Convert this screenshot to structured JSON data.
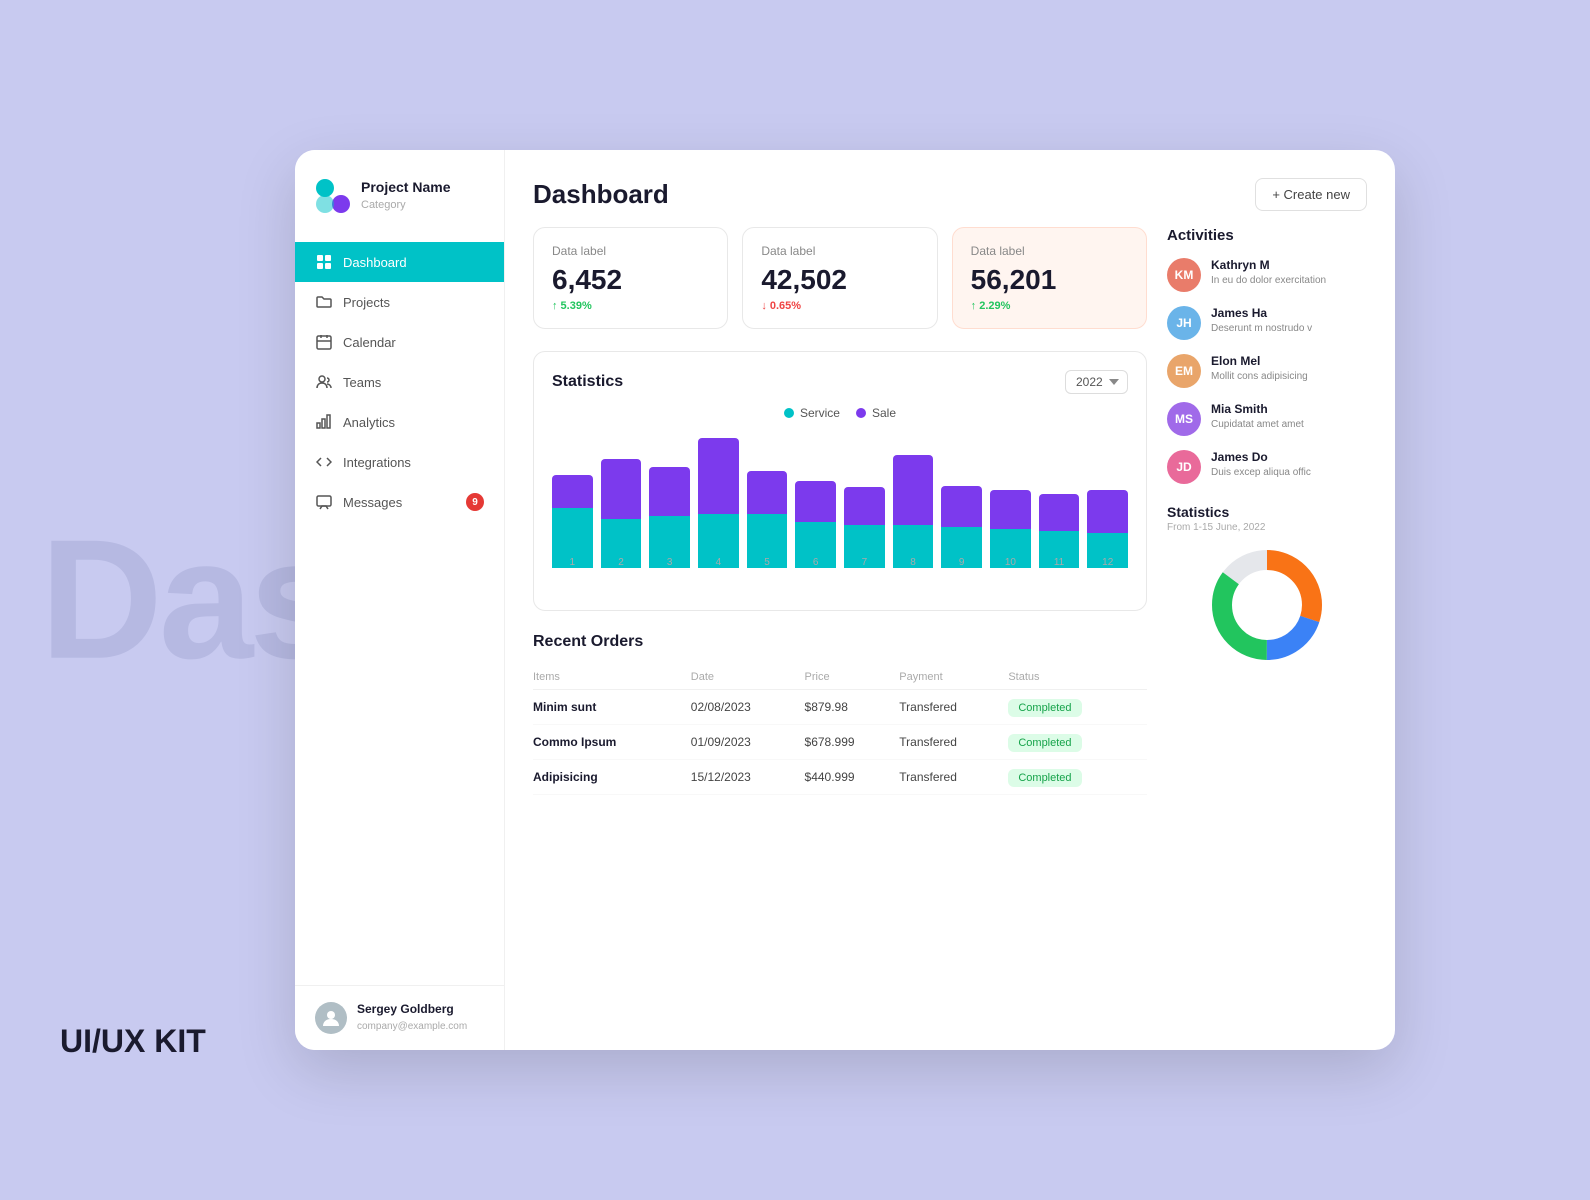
{
  "background_text": "Dashboard",
  "ui_kit_label": "UI/UX KIT",
  "logo": {
    "name": "Project Name",
    "category": "Category"
  },
  "nav": {
    "items": [
      {
        "id": "dashboard",
        "label": "Dashboard",
        "icon": "grid",
        "active": true
      },
      {
        "id": "projects",
        "label": "Projects",
        "icon": "folder"
      },
      {
        "id": "calendar",
        "label": "Calendar",
        "icon": "calendar"
      },
      {
        "id": "teams",
        "label": "Teams",
        "icon": "users"
      },
      {
        "id": "analytics",
        "label": "Analytics",
        "icon": "chart"
      },
      {
        "id": "integrations",
        "label": "Integrations",
        "icon": "code"
      },
      {
        "id": "messages",
        "label": "Messages",
        "icon": "message",
        "badge": "9"
      }
    ]
  },
  "user": {
    "name": "Sergey Goldberg",
    "email": "company@example.com"
  },
  "header": {
    "title": "Dashboard",
    "create_button": "+ Create new"
  },
  "stats": [
    {
      "label": "Data label",
      "value": "6,452",
      "change": "↑ 5.39%",
      "trend": "up"
    },
    {
      "label": "Data label",
      "value": "42,502",
      "change": "↓ 0.65%",
      "trend": "down"
    },
    {
      "label": "Data label",
      "value": "56,201",
      "change": "↑ 2.29%",
      "trend": "up",
      "style": "orange"
    }
  ],
  "chart": {
    "title": "Statistics",
    "year": "2022",
    "legend": [
      {
        "label": "Service",
        "color": "#00c2c7"
      },
      {
        "label": "Sale",
        "color": "#7c3aed"
      }
    ],
    "bars": [
      {
        "month": "1",
        "service": 55,
        "sale": 30
      },
      {
        "month": "2",
        "service": 45,
        "sale": 55
      },
      {
        "month": "3",
        "service": 48,
        "sale": 45
      },
      {
        "month": "4",
        "service": 50,
        "sale": 70
      },
      {
        "month": "5",
        "service": 50,
        "sale": 40
      },
      {
        "month": "6",
        "service": 42,
        "sale": 38
      },
      {
        "month": "7",
        "service": 40,
        "sale": 35
      },
      {
        "month": "8",
        "service": 40,
        "sale": 65
      },
      {
        "month": "9",
        "service": 38,
        "sale": 38
      },
      {
        "month": "10",
        "service": 36,
        "sale": 36
      },
      {
        "month": "11",
        "service": 34,
        "sale": 34
      },
      {
        "month": "12",
        "service": 32,
        "sale": 40
      }
    ]
  },
  "orders": {
    "title": "Recent Orders",
    "columns": [
      "Items",
      "Date",
      "Price",
      "Payment",
      "Status"
    ],
    "rows": [
      {
        "item": "Minim sunt",
        "date": "02/08/2023",
        "price": "$879.98",
        "payment": "Transfered",
        "status": "Completed"
      },
      {
        "item": "Commo Ipsum",
        "date": "01/09/2023",
        "price": "$678.999",
        "payment": "Transfered",
        "status": "Completed"
      },
      {
        "item": "Adipisicing",
        "date": "15/12/2023",
        "price": "$440.999",
        "payment": "Transfered",
        "status": "Completed"
      }
    ]
  },
  "activities": {
    "title": "Activities",
    "items": [
      {
        "name": "Kathryn M",
        "text": "In eu do dolor exercitation",
        "color": "#e97c6a"
      },
      {
        "name": "James Ha",
        "text": "Deserunt m nostrudo v",
        "color": "#6ab4e9"
      },
      {
        "name": "Elon Mel",
        "text": "Mollit cons adipisicing",
        "color": "#e9a56a"
      },
      {
        "name": "Mia Smith",
        "text": "Cupidatat amet amet",
        "color": "#a06ae9"
      },
      {
        "name": "James Do",
        "text": "Duis excep aliqua offic",
        "color": "#e96a9a"
      }
    ]
  },
  "right_stats": {
    "title": "Statistics",
    "subtitle": "From 1-15 June, 2022",
    "donut": {
      "segments": [
        {
          "color": "#f97316",
          "pct": 30
        },
        {
          "color": "#3b82f6",
          "pct": 20
        },
        {
          "color": "#22c55e",
          "pct": 35
        },
        {
          "color": "#e5e7eb",
          "pct": 15
        }
      ]
    }
  }
}
